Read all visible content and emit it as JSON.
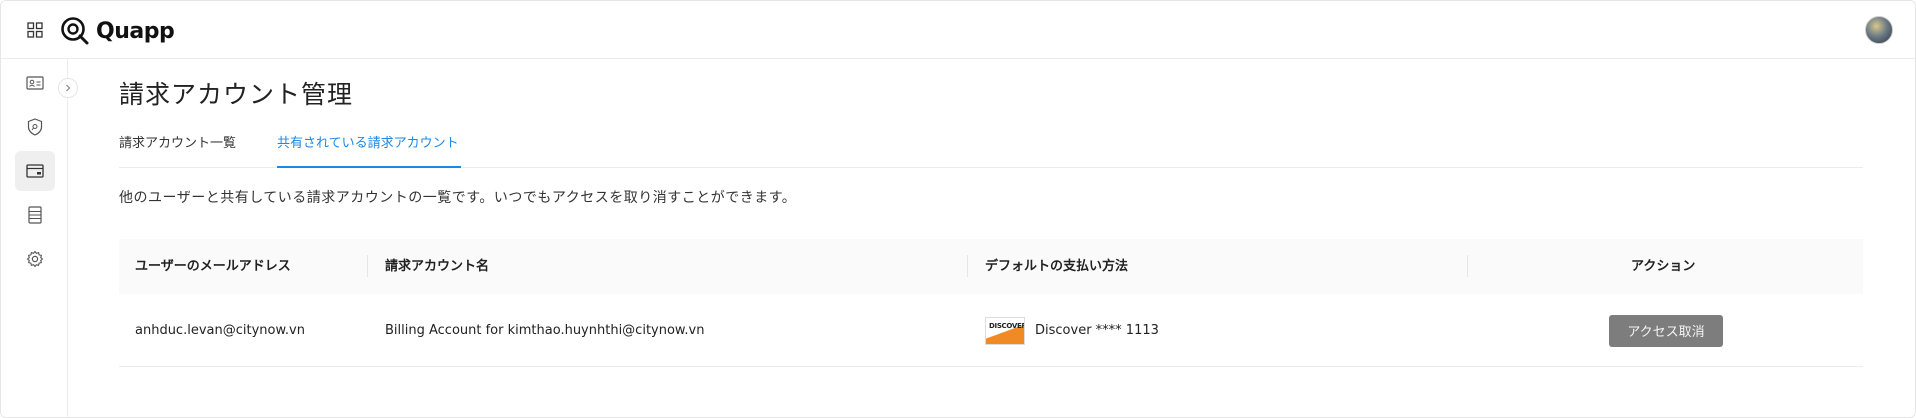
{
  "app": {
    "name": "Quapp"
  },
  "header": {
    "grid_icon": "apps-grid-icon",
    "avatar_icon": "user-avatar"
  },
  "sidebar": {
    "items": [
      {
        "name": "profile-card-icon",
        "active": false
      },
      {
        "name": "security-shield-icon",
        "active": false
      },
      {
        "name": "billing-card-icon",
        "active": true
      },
      {
        "name": "document-list-icon",
        "active": false
      },
      {
        "name": "settings-gear-icon",
        "active": false
      }
    ]
  },
  "page": {
    "title": "請求アカウント管理",
    "tabs": [
      {
        "label": "請求アカウント一覧",
        "active": false
      },
      {
        "label": "共有されている請求アカウント",
        "active": true
      }
    ],
    "description": "他のユーザーと共有している請求アカウントの一覧です。いつでもアクセスを取り消すことができます。"
  },
  "table": {
    "headers": [
      "ユーザーのメールアドレス",
      "請求アカウント名",
      "デフォルトの支払い方法",
      "アクション"
    ],
    "rows": [
      {
        "email": "anhduc.levan@citynow.vn",
        "account_name": "Billing Account for kimthao.huynhthi@citynow.vn",
        "payment_brand": "DISCOVER",
        "payment_method": "Discover **** 1113",
        "action_label": "アクセス取消"
      }
    ]
  },
  "colors": {
    "accent": "#1e88e5",
    "button_gray": "#7d7d7d",
    "discover_orange": "#f08a24"
  }
}
